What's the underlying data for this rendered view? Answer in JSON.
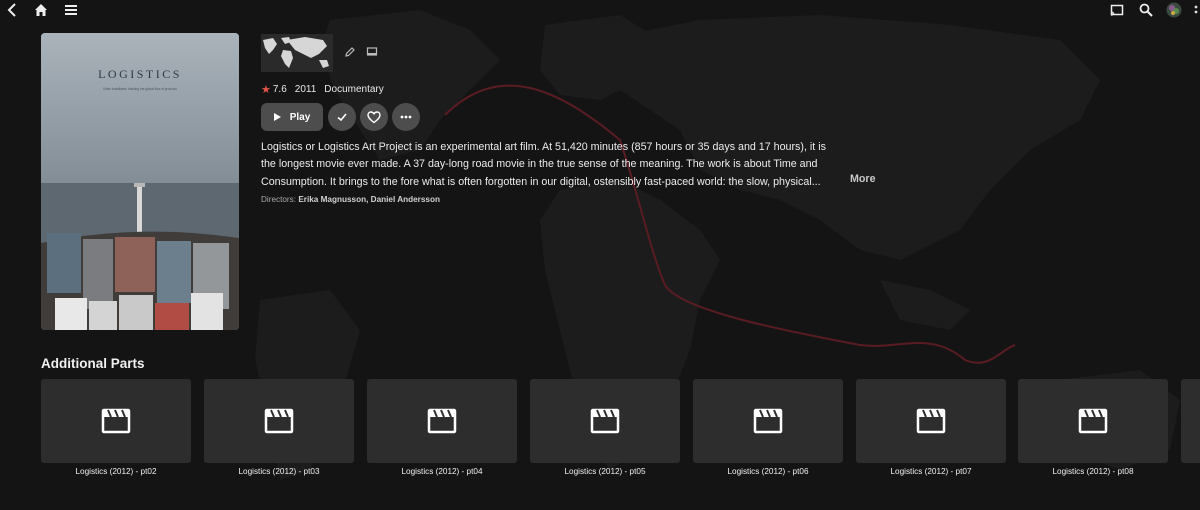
{
  "nav": {
    "back_icon": "chevron-left-icon",
    "home_icon": "home-icon",
    "menu_icon": "hamburger-menu-icon",
    "cast_icon": "cast-icon",
    "search_icon": "search-icon",
    "avatar_icon": "user-avatar-icon",
    "more_icon": "settings-icon"
  },
  "poster": {
    "title": "LOGISTICS",
    "tagline": "Video installation tracking the global flow of products"
  },
  "movie": {
    "rating": "7.6",
    "year": "2011",
    "genre": "Documentary",
    "play_label": "Play",
    "summary": "Logistics or Logistics Art Project is an experimental art film. At 51,420 minutes (857 hours or 35 days and 17 hours), it is the longest movie ever made. A 37 day-long road movie in the true sense of the meaning. The work is about Time and Consumption. It brings to the fore what is often forgotten in our digital, ostensibly fast-paced world: the slow, physical...",
    "more_label": "More",
    "directors_label": "Directors:",
    "directors": "Erika Magnusson, Daniel Andersson"
  },
  "additional_parts": {
    "title": "Additional Parts",
    "items": [
      {
        "label": "Logistics (2012) - pt02"
      },
      {
        "label": "Logistics (2012) - pt03"
      },
      {
        "label": "Logistics (2012) - pt04"
      },
      {
        "label": "Logistics (2012) - pt05"
      },
      {
        "label": "Logistics (2012) - pt06"
      },
      {
        "label": "Logistics (2012) - pt07"
      },
      {
        "label": "Logistics (2012) - pt08"
      }
    ]
  },
  "colors": {
    "background": "#141414",
    "button": "#4d4d4d",
    "tile": "#2d2d2d",
    "rating_star": "#e5544b",
    "route_line": "#5a1c22"
  }
}
